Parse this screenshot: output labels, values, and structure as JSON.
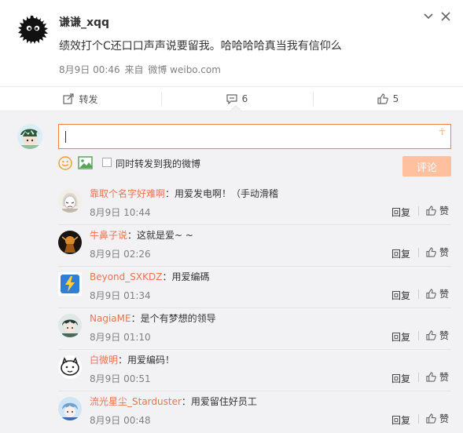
{
  "post": {
    "author": "谦谦_xqq",
    "text": "绩效打个C还口口声声说要留我。哈哈哈哈真当我有信仰么",
    "date": "8月9日 00:46",
    "source_prefix": "来自",
    "source": "微博 weibo.com"
  },
  "actions": {
    "repost_label": "转发",
    "comment_count": "6",
    "like_count": "5"
  },
  "composer": {
    "input_value": "",
    "also_repost_label": "同时转发到我的微博",
    "submit_label": "评论",
    "submit_color": "#ffc09f"
  },
  "comments": [
    {
      "user": "靠取个名字好难啊",
      "text": "：用爱发电啊！（手动滑稽",
      "time": "8月9日 10:44",
      "reply": "回复",
      "like": "赞"
    },
    {
      "user": "牛鼻子说",
      "text": "：这就是爱~ ~",
      "time": "8月9日 02:26",
      "reply": "回复",
      "like": "赞"
    },
    {
      "user": "Beyond_SXKDZ",
      "text": "：用爱编碼",
      "time": "8月9日 01:34",
      "reply": "回复",
      "like": "赞"
    },
    {
      "user": "NagiaME",
      "text": "：是个有梦想的领导",
      "time": "8月9日 01:10",
      "reply": "回复",
      "like": "赞"
    },
    {
      "user": "白微明",
      "text": "：用爱编码！",
      "time": "8月9日 00:51",
      "reply": "回复",
      "like": "赞"
    },
    {
      "user": "流光星尘_Starduster",
      "text": "：用爱留住好员工",
      "time": "8月9日 00:48",
      "reply": "回复",
      "like": "赞"
    }
  ],
  "colors": {
    "accent": "#eb7350",
    "input_border": "#fa7d3c",
    "panel_bg": "#f2f2f5"
  }
}
